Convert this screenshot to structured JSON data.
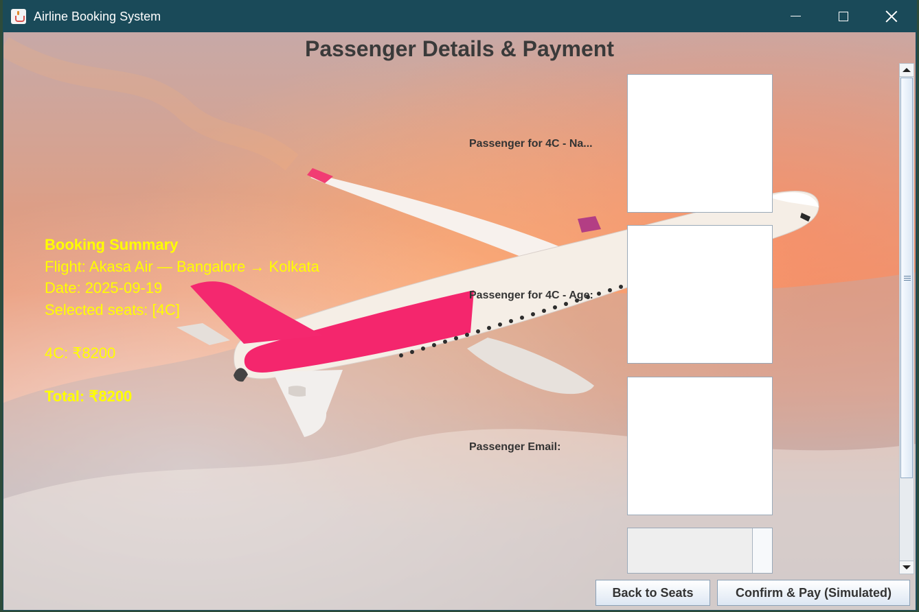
{
  "window": {
    "title": "Airline Booking System"
  },
  "page": {
    "title": "Passenger Details & Payment"
  },
  "summary": {
    "heading": "Booking Summary",
    "flight": "Flight: Akasa Air — Bangalore → Kolkata",
    "date": "Date: 2025-09-19",
    "seats": "Selected seats: [4C]",
    "seat_price": "4C: ₹8200",
    "total": "Total: ₹8200"
  },
  "form": {
    "name_label": "Passenger for 4C - Na...",
    "age_label": "Passenger for 4C - Age:",
    "email_label": "Passenger Email:",
    "name_value": "",
    "age_value": "",
    "email_value": "",
    "dropdown_value": ""
  },
  "buttons": {
    "back": "Back to Seats",
    "confirm": "Confirm & Pay (Simulated)"
  },
  "icons": {
    "app": "java-coffee-icon",
    "minimize": "minimize-icon",
    "maximize": "maximize-icon",
    "close": "close-icon",
    "scroll_up": "arrow-up-icon",
    "scroll_down": "arrow-down-icon"
  },
  "colors": {
    "titlebar": "#1a4a59",
    "summary_text": "#ffff00",
    "page_title": "#3a3a3a"
  },
  "scroll": {
    "thumb_fraction": 0.8
  }
}
